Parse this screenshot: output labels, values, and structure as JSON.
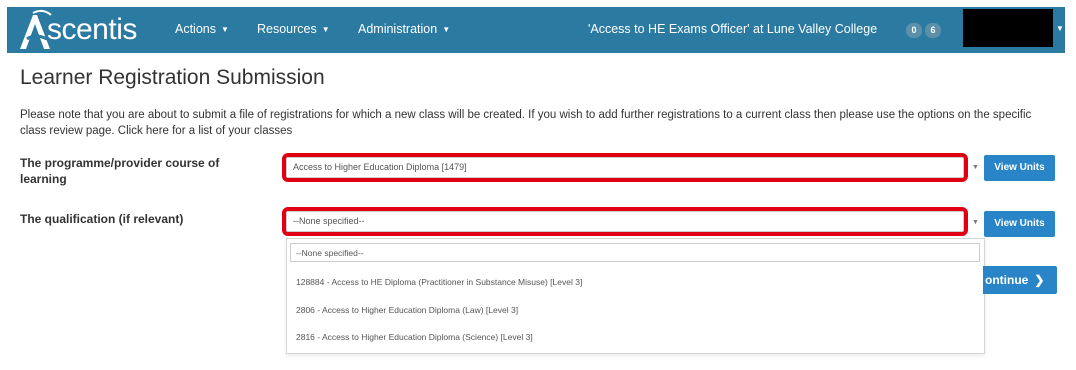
{
  "navbar": {
    "logo_text": "scentis",
    "items": [
      {
        "label": "Actions"
      },
      {
        "label": "Resources"
      },
      {
        "label": "Administration"
      }
    ],
    "user_role": "'Access to HE Exams Officer' at Lune Valley College",
    "badges": [
      "0",
      "6"
    ],
    "color": "#2b7aa2"
  },
  "page": {
    "title": "Learner Registration Submission",
    "intro": "Please note that you are about to submit a file of registrations for which a new class will be created. If you wish to add further registrations to a current class then please use the options on the specific class review page. Click here for a list of your classes"
  },
  "form": {
    "programme_label": "The programme/provider course of learning",
    "programme_value": "Access to Higher Education Diploma [1479]",
    "qualification_label": "The qualification (if relevant)",
    "qualification_value": "--None specified--",
    "view_units_label": "View Units",
    "continue_label": "ontinue",
    "highlight_color": "#e00012"
  },
  "dropdown": {
    "search_value": "--None specified--",
    "options": [
      "128884 - Access to HE Diploma (Practitioner in Substance Misuse) [Level 3]",
      "2806 - Access to Higher Education Diploma (Law) [Level 3]",
      "2816 - Access to Higher Education Diploma (Science) [Level 3]"
    ]
  }
}
